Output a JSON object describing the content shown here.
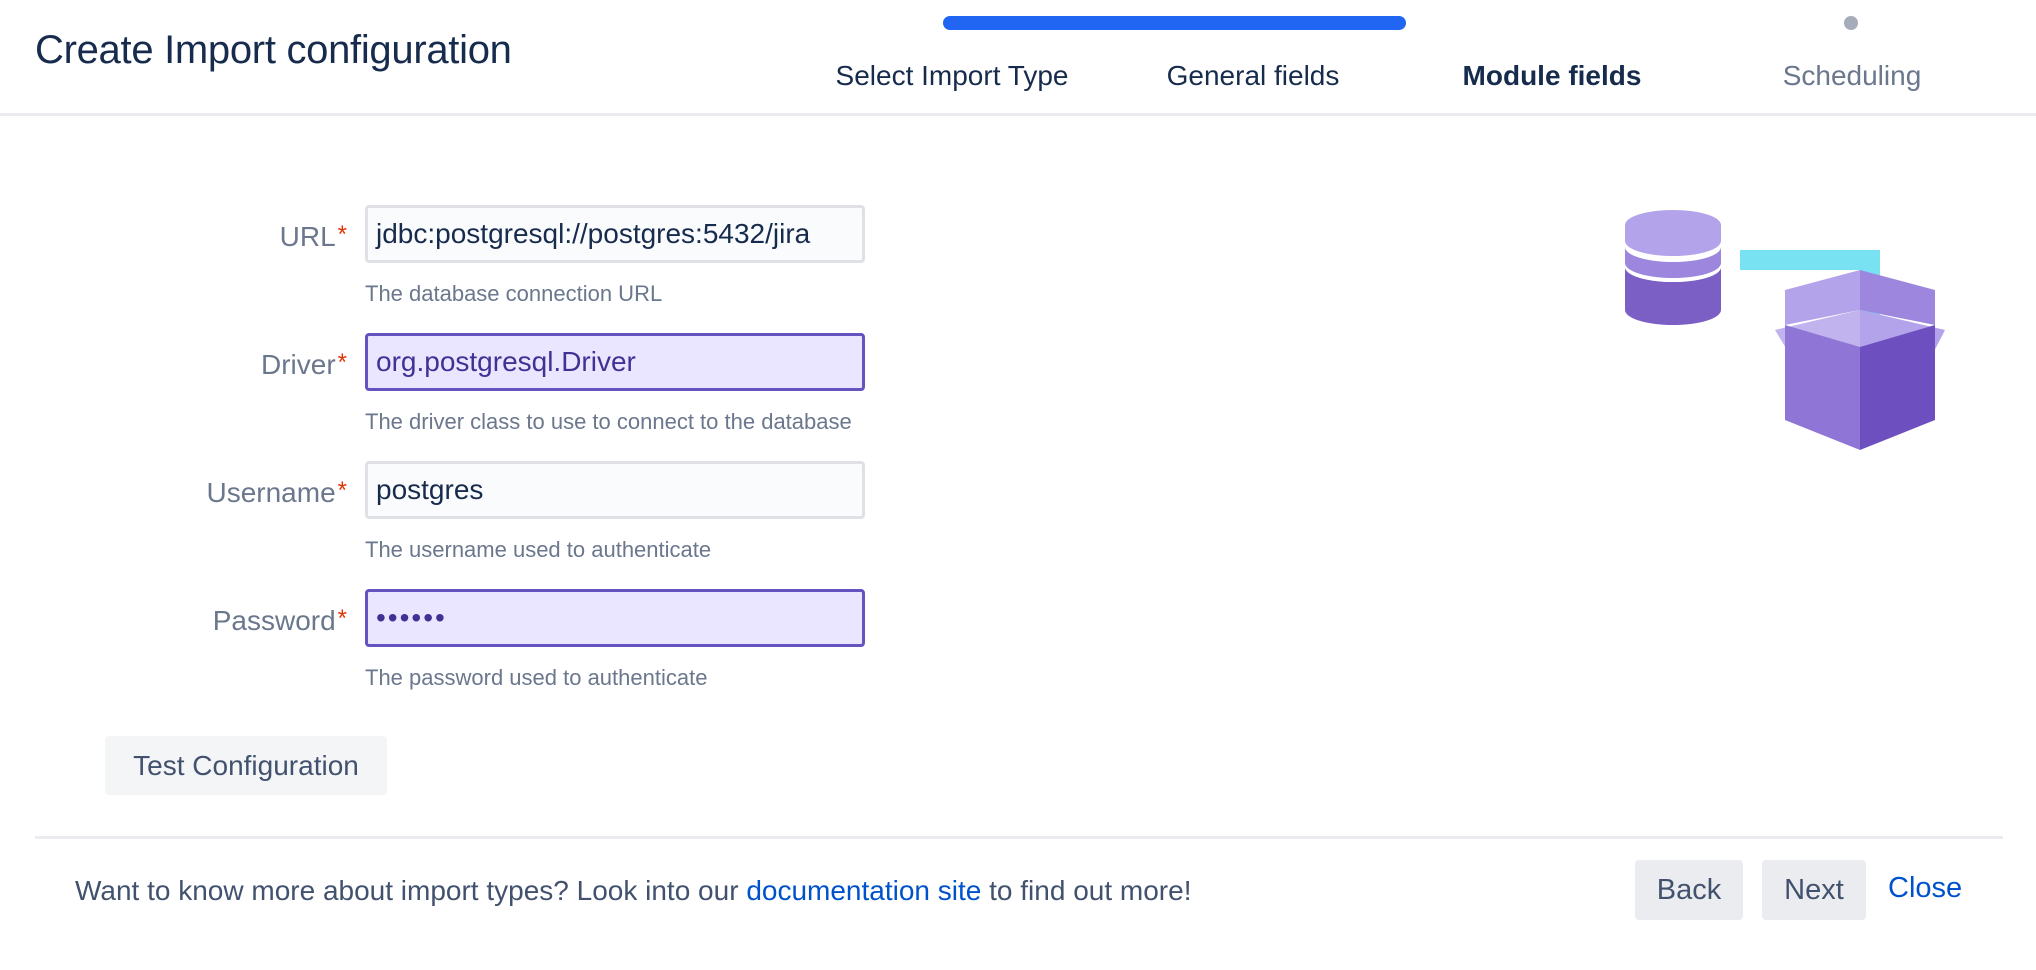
{
  "header": {
    "title": "Create Import configuration",
    "progress_percent": 75,
    "steps": [
      {
        "label": "Select Import Type",
        "state": "done"
      },
      {
        "label": "General fields",
        "state": "done"
      },
      {
        "label": "Module fields",
        "state": "current"
      },
      {
        "label": "Scheduling",
        "state": "future"
      }
    ]
  },
  "form": {
    "required_marker": "*",
    "fields": [
      {
        "label": "URL",
        "value": "jdbc:postgresql://postgres:5432/jira",
        "help": "The database connection URL"
      },
      {
        "label": "Driver",
        "value": "org.postgresql.Driver",
        "help": "The driver class to use to connect to the database"
      },
      {
        "label": "Username",
        "value": "postgres",
        "help": "The username used to authenticate"
      },
      {
        "label": "Password",
        "value": "••••••",
        "help": "The password used to authenticate"
      }
    ],
    "test_button": "Test Configuration"
  },
  "illustration": {
    "icon": "database-import-box-icon"
  },
  "footer": {
    "text_before": "Want to know more about import types? Look into our ",
    "link_text": "documentation site",
    "text_after": " to find out more!",
    "back_label": "Back",
    "next_label": "Next",
    "close_label": "Close"
  },
  "colors": {
    "progress": "#2166f3",
    "autofill_border": "#6554c0",
    "autofill_background": "#eae6ff",
    "link": "#0052cc",
    "required": "#de350b"
  }
}
